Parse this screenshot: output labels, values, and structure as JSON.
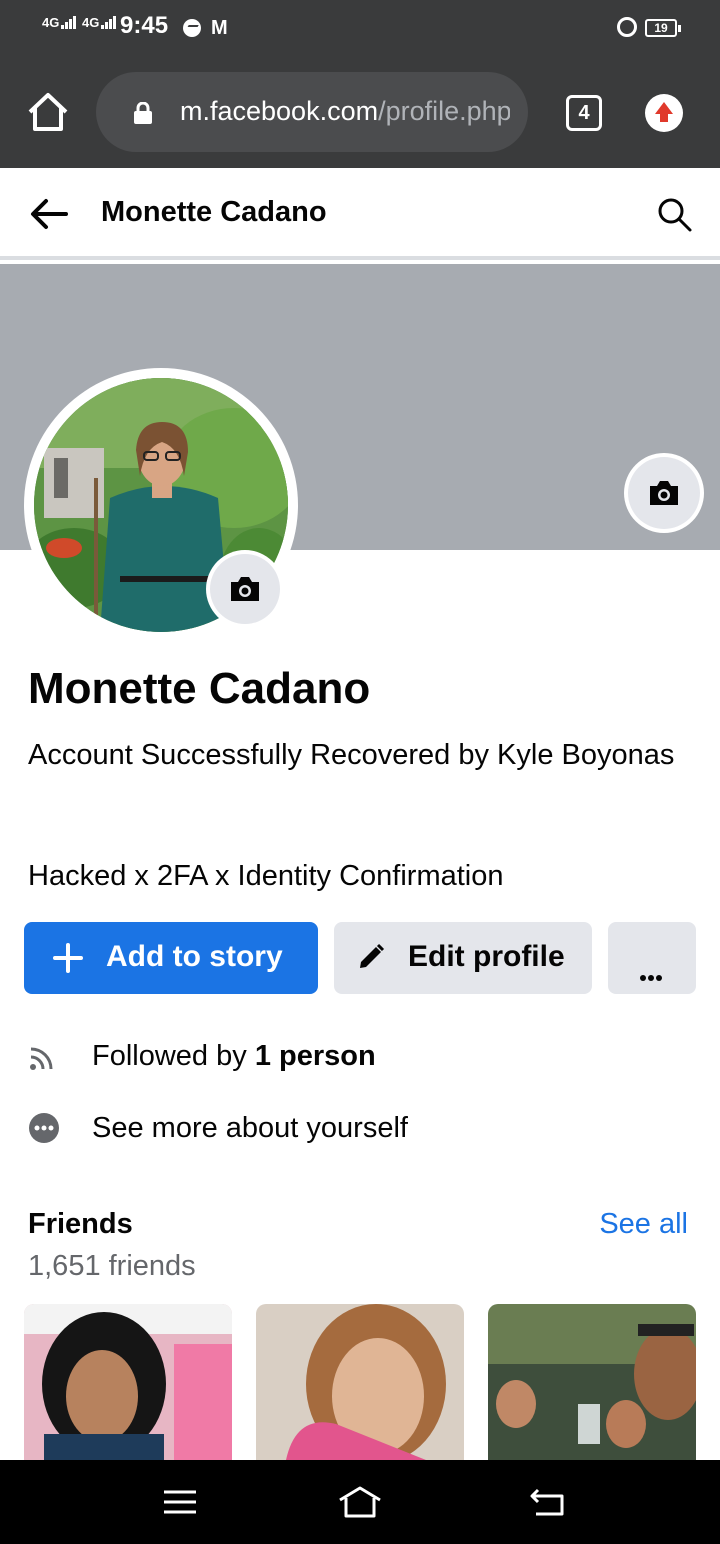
{
  "status_bar": {
    "signal1": "4G",
    "signal2": "4G",
    "time": "9:45",
    "gmail_icon": "M",
    "battery": "19"
  },
  "browser": {
    "url_host": "m.facebook.com",
    "url_path": "/profile.php",
    "tab_count": "4"
  },
  "header": {
    "title": "Monette Cadano"
  },
  "profile": {
    "name": "Monette Cadano",
    "bio_line1": "Account Successfully Recovered by Kyle Boyonas",
    "bio_line2": "Hacked x 2FA x Identity Confirmation"
  },
  "actions": {
    "add_story": "Add to story",
    "edit_profile": "Edit profile"
  },
  "info": {
    "followed_prefix": "Followed by ",
    "followed_count": "1 person",
    "see_more": "See more about yourself"
  },
  "friends": {
    "heading": "Friends",
    "see_all": "See all",
    "count": "1,651 friends"
  },
  "colors": {
    "accent": "#1b74e4",
    "browser_bar": "#3a3b3c",
    "cover": "#a7abb1"
  }
}
